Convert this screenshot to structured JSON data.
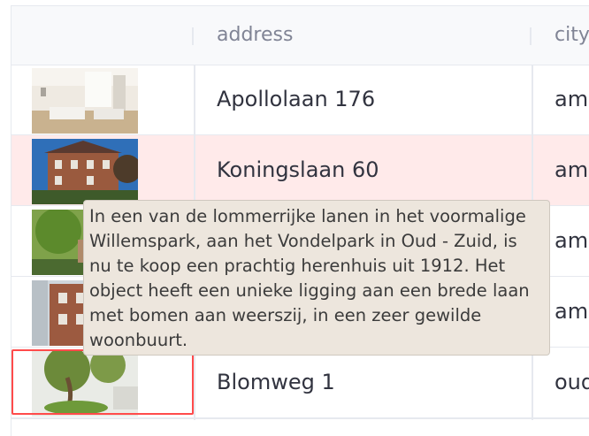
{
  "table": {
    "columns": [
      "",
      "address",
      "city"
    ],
    "rows": [
      {
        "address": "Apollolaan 176",
        "city": "ams",
        "image": "interior-living-room"
      },
      {
        "address": "Koningslaan 60",
        "city": "ams",
        "image": "brick-mansion"
      },
      {
        "address": "",
        "city": "ams",
        "image": "tree-lined-house"
      },
      {
        "address": "",
        "city": "ams",
        "image": "brick-townhouse"
      },
      {
        "address": "Blomweg 1",
        "city": "oud",
        "image": "garden-tree"
      }
    ]
  },
  "tooltip": {
    "text": "In een van de lommerrijke lanen in het voormalige Willemspark, aan het Vondelpark in Oud - Zuid, is nu te koop een prachtig herenhuis uit 1912. Het object heeft een unieke ligging aan een brede laan met bomen aan weerszij, in een zeer gewilde woonbuurt."
  },
  "colors": {
    "highlight_row": "#ffeaea",
    "selected_outline": "#ff4b4b",
    "tooltip_bg": "#ede6dd"
  }
}
